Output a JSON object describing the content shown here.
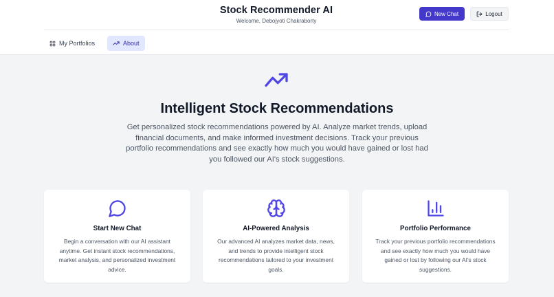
{
  "header": {
    "title": "Stock Recommender AI",
    "subtitle": "Welcome, Debojyoti Chakraborty",
    "new_chat_label": "New Chat",
    "logout_label": "Logout"
  },
  "nav": {
    "items": [
      {
        "label": "My Portfolios",
        "icon": "grid-icon",
        "active": false
      },
      {
        "label": "About",
        "icon": "trending-up-icon",
        "active": true
      }
    ]
  },
  "hero": {
    "icon": "trending-up-icon",
    "title": "Intelligent Stock Recommendations",
    "description": "Get personalized stock recommendations powered by AI. Analyze market trends, upload financial documents, and make informed investment decisions. Track your previous portfolio recommendations and see exactly how much you would have gained or lost had you followed our AI's stock suggestions."
  },
  "features": [
    {
      "icon": "chat-bubble-icon",
      "title": "Start New Chat",
      "description": "Begin a conversation with our AI assistant anytime. Get instant stock recommendations, market analysis, and personalized investment advice."
    },
    {
      "icon": "brain-icon",
      "title": "AI-Powered Analysis",
      "description": "Our advanced AI analyzes market data, news, and trends to provide intelligent stock recommendations tailored to your investment goals."
    },
    {
      "icon": "bar-chart-icon",
      "title": "Portfolio Performance",
      "description": "Track your previous portfolio recommendations and see exactly how much you would have gained or lost by following our AI's stock suggestions."
    }
  ],
  "colors": {
    "accent": "#4338ca",
    "icon": "#4f46e5",
    "active_nav_bg": "#e0e7ff",
    "page_bg": "#f3f4f6"
  }
}
